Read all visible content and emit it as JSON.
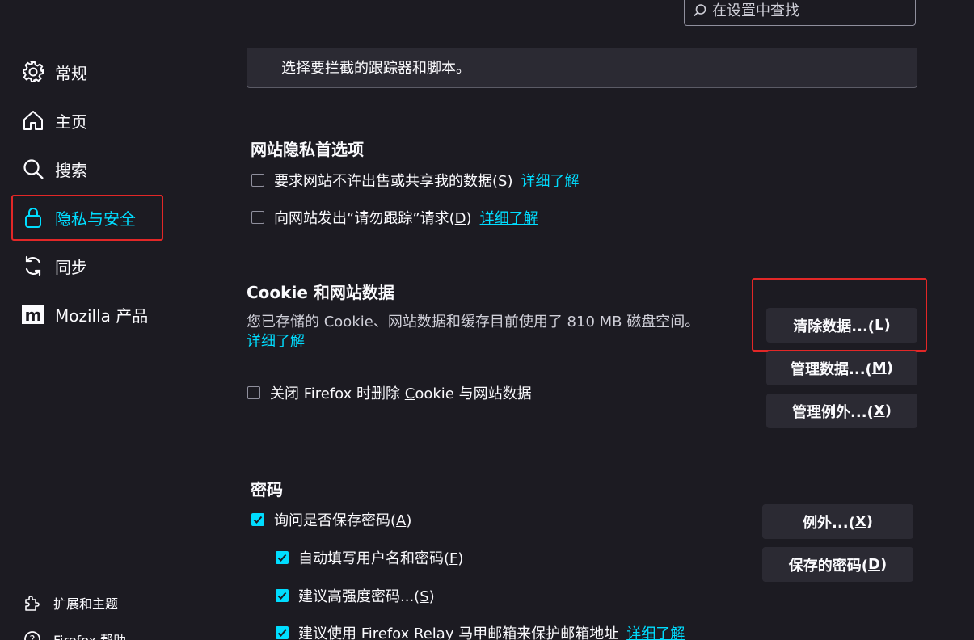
{
  "search": {
    "placeholder": "在设置中查找"
  },
  "sidebar": {
    "items": [
      {
        "label": "常规",
        "icon": "gear-icon"
      },
      {
        "label": "主页",
        "icon": "home-icon"
      },
      {
        "label": "搜索",
        "icon": "search-icon"
      },
      {
        "label": "隐私与安全",
        "icon": "lock-icon",
        "selected": true
      },
      {
        "label": "同步",
        "icon": "sync-icon"
      },
      {
        "label": "Mozilla 产品",
        "icon": "mozilla-icon"
      }
    ],
    "footer": [
      {
        "label": "扩展和主题",
        "icon": "puzzle-icon"
      },
      {
        "label": "Firefox 帮助",
        "icon": "help-icon"
      }
    ]
  },
  "trackers": {
    "text": "选择要拦截的跟踪器和脚本。"
  },
  "website_privacy": {
    "heading": "网站隐私首选项",
    "options": [
      {
        "label_pre": "要求网站不许出售或共享我的数据(",
        "key": "S",
        "label_post": ")",
        "link": "详细了解",
        "checked": false
      },
      {
        "label_pre": "向网站发出“请勿跟踪”请求(",
        "key": "D",
        "label_post": ")",
        "link": "详细了解",
        "checked": false
      }
    ]
  },
  "cookies": {
    "heading": "Cookie 和网站数据",
    "description": "您已存储的 Cookie、网站数据和缓存目前使用了 810 MB 磁盘空间。",
    "learn_more": "详细了解",
    "clear_button": {
      "pre": "清除数据...(",
      "key": "L",
      "post": ")"
    },
    "manage_button": {
      "pre": "管理数据...(",
      "key": "M",
      "post": ")"
    },
    "exceptions_button": {
      "pre": "管理例外...(",
      "key": "X",
      "post": ")"
    },
    "delete_on_close": {
      "pre": "关闭 Firefox 时删除 ",
      "key": "C",
      "post": "ookie 与网站数据",
      "checked": false
    }
  },
  "passwords": {
    "heading": "密码",
    "ask_save": {
      "pre": "询问是否保存密码(",
      "key": "A",
      "post": ")",
      "checked": true
    },
    "autofill": {
      "pre": "自动填写用户名和密码(",
      "key": "F",
      "post": ")",
      "checked": true
    },
    "suggest_strong": {
      "pre": "建议高强度密码...(",
      "key": "S",
      "post": ")",
      "checked": true
    },
    "relay": {
      "label": "建议使用 Firefox Relay 马甲邮箱来保护邮箱地址",
      "link": "详细了解",
      "checked": true
    },
    "exceptions_button": {
      "pre": "例外...(",
      "key": "X",
      "post": ")"
    },
    "saved_button": {
      "pre": "保存的密码(",
      "key": "D",
      "post": ")"
    }
  },
  "colors": {
    "accent": "#00ddff",
    "background": "#1c1b22",
    "button": "#2b2a33",
    "highlight": "#e22727"
  }
}
